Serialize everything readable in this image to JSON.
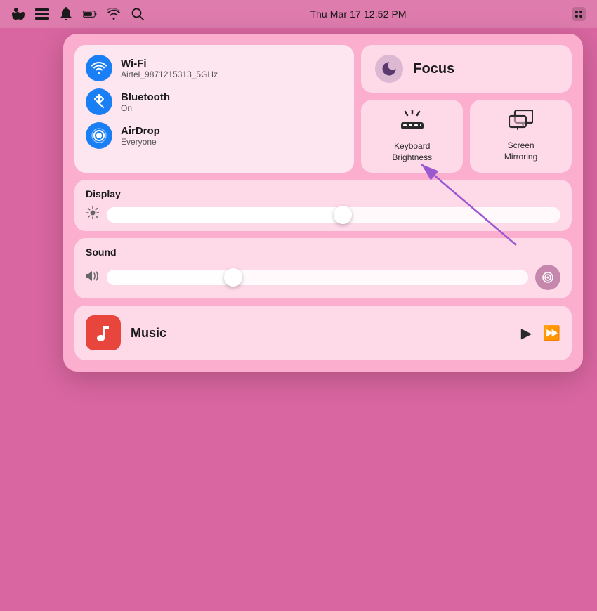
{
  "menubar": {
    "datetime": "Thu Mar 17  12:52 PM",
    "icons": [
      {
        "name": "taskbar-icon",
        "symbol": "✓"
      },
      {
        "name": "windows-icon",
        "symbol": "⣿"
      },
      {
        "name": "notification-icon",
        "symbol": "🔔"
      },
      {
        "name": "battery-icon",
        "symbol": "▬"
      },
      {
        "name": "wifi-icon",
        "symbol": "📶"
      },
      {
        "name": "search-icon",
        "symbol": "🔍"
      },
      {
        "name": "control-center-icon",
        "symbol": "⊟"
      }
    ]
  },
  "control_center": {
    "network": {
      "wifi": {
        "label": "Wi-Fi",
        "subtitle": "Airtel_9871215313_5GHz"
      },
      "bluetooth": {
        "label": "Bluetooth",
        "subtitle": "On"
      },
      "airdrop": {
        "label": "AirDrop",
        "subtitle": "Everyone"
      }
    },
    "focus": {
      "label": "Focus"
    },
    "keyboard_brightness": {
      "label": "Keyboard\nBrightness"
    },
    "screen_mirroring": {
      "label": "Screen\nMirroring"
    },
    "display": {
      "label": "Display",
      "slider_value": 52
    },
    "sound": {
      "label": "Sound",
      "slider_value": 30
    },
    "music": {
      "label": "Music"
    }
  }
}
